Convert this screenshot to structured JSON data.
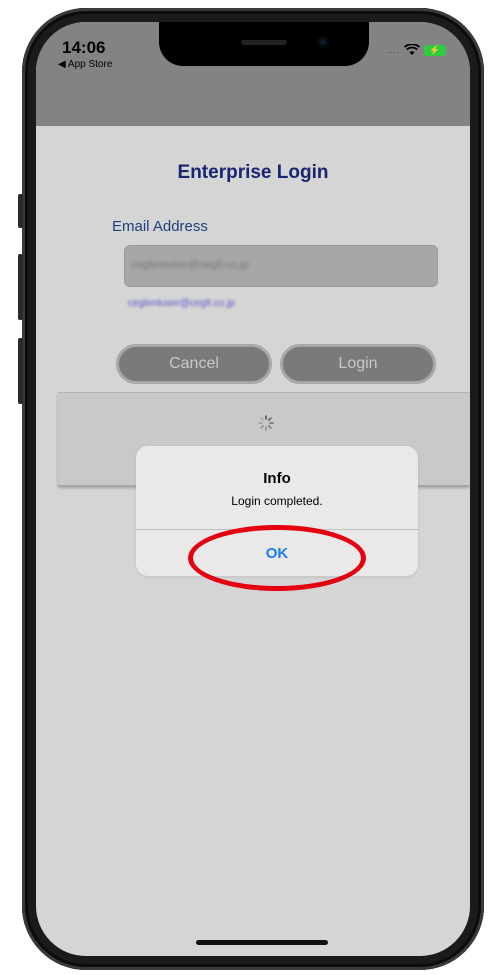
{
  "status_bar": {
    "time": "14:06",
    "back_label": "◀ App Store",
    "signal": "....",
    "battery_icon": "⚡"
  },
  "screen": {
    "title": "Enterprise Login",
    "email_label": "Email Address",
    "email_value": "ceglentuser@ceglt.co.jp",
    "email_hint": "ceglentuser@ceglt.co.jp"
  },
  "buttons": {
    "cancel": "Cancel",
    "login": "Login"
  },
  "alert": {
    "title": "Info",
    "message": "Login completed.",
    "ok": "OK"
  },
  "colors": {
    "alert_ok": "#1a7cf0",
    "highlight": "#e4000f",
    "title": "#1a2570"
  }
}
